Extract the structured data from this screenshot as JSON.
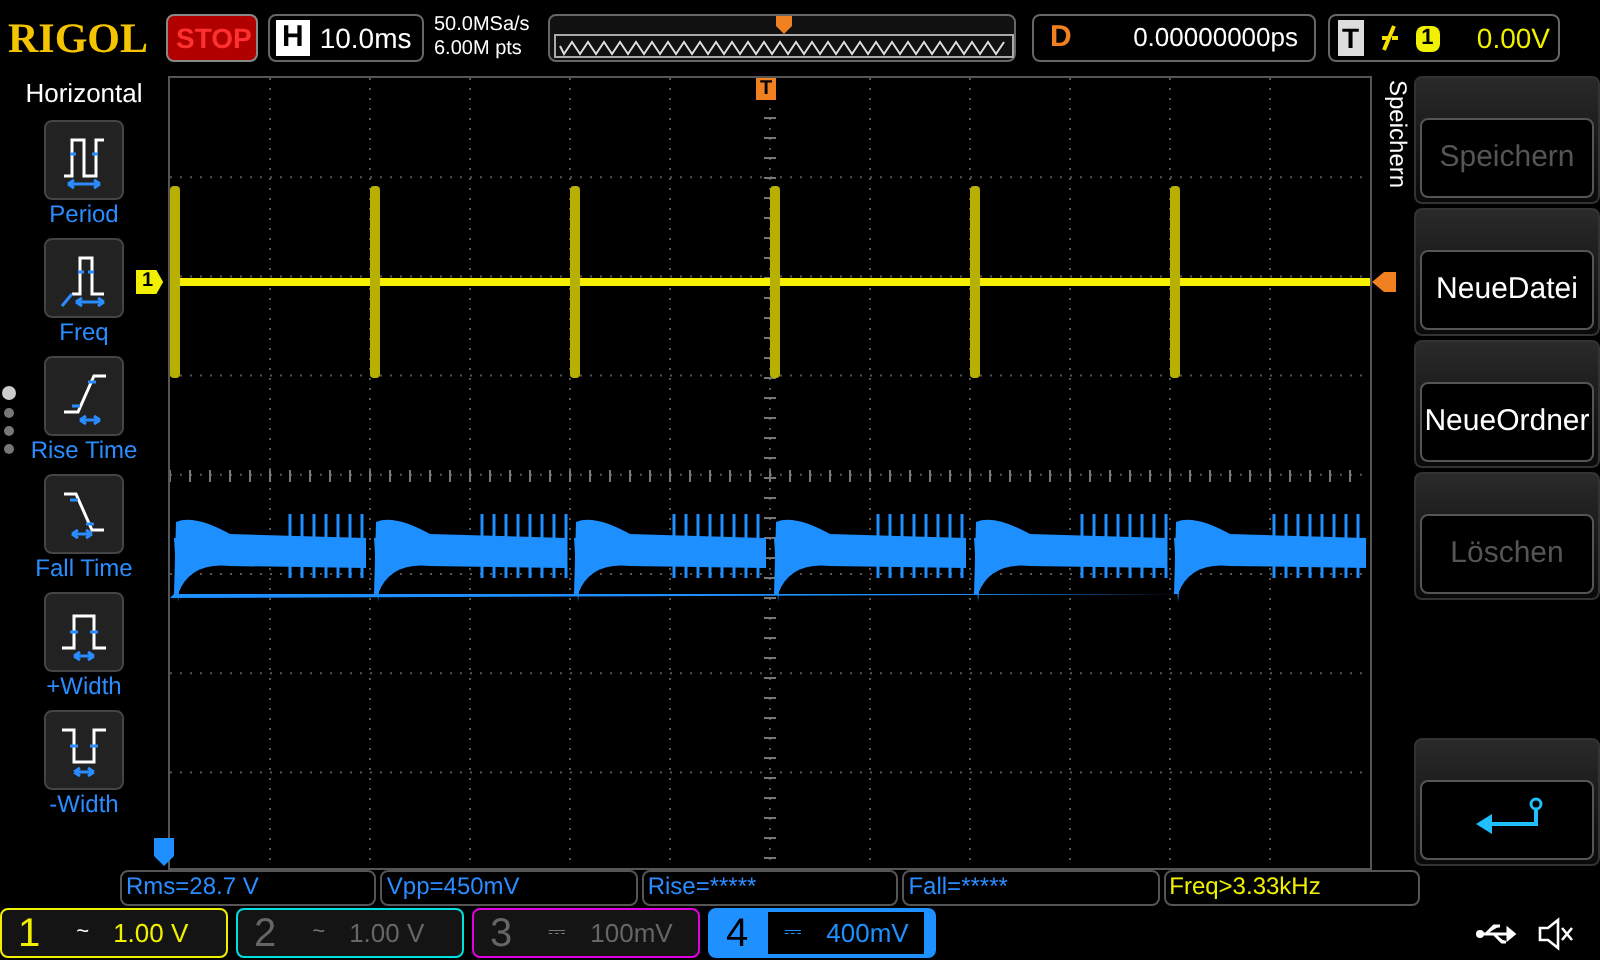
{
  "top_bar": {
    "brand": "RIGOL",
    "run_state": "STOP",
    "timebase": {
      "label": "H",
      "value": "10.0ms"
    },
    "sample_rate": "50.0MSa/s",
    "memory_depth": "6.00M pts",
    "delay": {
      "label": "D",
      "value": "0.00000000ps"
    },
    "trigger": {
      "label": "T",
      "source": "1",
      "level": "0.00V"
    }
  },
  "left_menu": {
    "title": "Horizontal",
    "items": [
      {
        "kind": "period",
        "label": "Period"
      },
      {
        "kind": "freq",
        "label": "Freq"
      },
      {
        "kind": "rise",
        "label": "Rise Time"
      },
      {
        "kind": "fall",
        "label": "Fall Time"
      },
      {
        "kind": "pwidth",
        "label": "+Width"
      },
      {
        "kind": "nwidth",
        "label": "-Width"
      }
    ],
    "page_dots": [
      {
        "selected": true
      },
      {
        "selected": false
      },
      {
        "selected": false
      },
      {
        "selected": false
      }
    ]
  },
  "grid": {
    "trigger_marker": "T",
    "channel_marker": "1"
  },
  "right_menu": {
    "title": "Speichern",
    "buttons": [
      {
        "kind": "text",
        "label": "Speichern",
        "disabled": true
      },
      {
        "kind": "text",
        "label": "NeueDatei",
        "disabled": false
      },
      {
        "kind": "text",
        "label": "NeueOrdner",
        "disabled": false
      },
      {
        "kind": "text",
        "label": "Löschen",
        "disabled": true
      },
      {
        "kind": "spacer"
      },
      {
        "kind": "back"
      }
    ]
  },
  "measurements": [
    "Rms=28.7 V",
    "Vpp=450mV",
    "Rise=*****",
    "Fall=*****",
    "Freq>3.33kHz"
  ],
  "channels": [
    {
      "number": "1",
      "coupling": "~",
      "scale": "1.00 V",
      "on": true,
      "selected": false,
      "color": "#f0f000"
    },
    {
      "number": "2",
      "coupling": "~",
      "scale": "1.00 V",
      "on": false,
      "selected": false,
      "color": "#00e0e0"
    },
    {
      "number": "3",
      "coupling": "⎓",
      "scale": "100mV",
      "on": false,
      "selected": false,
      "color": "#e000e0"
    },
    {
      "number": "4",
      "coupling": "⎓",
      "scale": "400mV",
      "on": true,
      "selected": true,
      "color": "#1e90ff"
    }
  ]
}
